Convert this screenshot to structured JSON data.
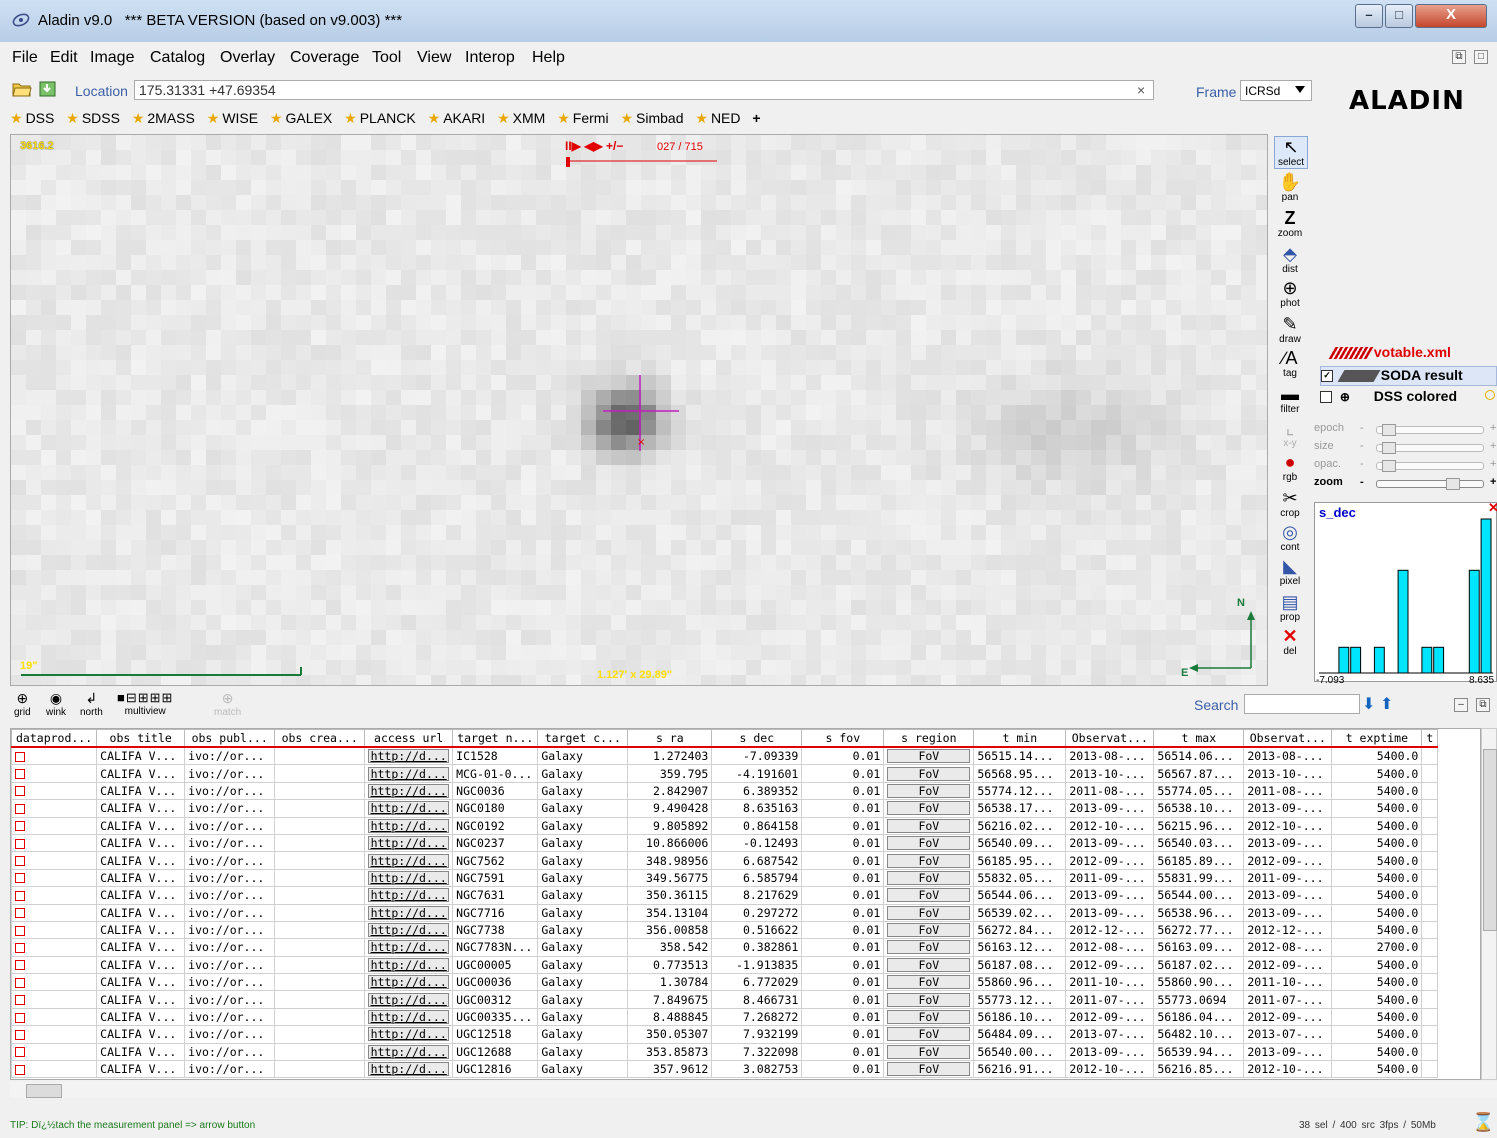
{
  "window": {
    "title": "Aladin v9.0   *** BETA VERSION (based on v9.003) ***",
    "min_label": "–",
    "max_label": "□",
    "close_label": "X"
  },
  "menu": [
    "File",
    "Edit",
    "Image",
    "Catalog",
    "Overlay",
    "Coverage",
    "Tool",
    "View",
    "Interop",
    "Help"
  ],
  "location": {
    "label": "Location",
    "value": "175.31331 +47.69354",
    "clear": "×"
  },
  "frame": {
    "label": "Frame",
    "value": "ICRSd"
  },
  "logo": "ALADIN",
  "servers": [
    "DSS",
    "SDSS",
    "2MASS",
    "WISE",
    "GALEX",
    "PLANCK",
    "AKARI",
    "XMM",
    "Fermi",
    "Simbad",
    "NED"
  ],
  "servers_add": "+",
  "view": {
    "pixel_value": "3616.2",
    "scale_label": "19\"",
    "fov": "1.127' x 29.89\"",
    "cube_controls": "II▶ ◀▶ +/−",
    "cube_frame": "027 / 715",
    "north": "N",
    "east": "E"
  },
  "tools": [
    "select",
    "pan",
    "zoom",
    "dist",
    "phot",
    "draw",
    "tag",
    "filter",
    "x-y",
    "rgb",
    "crop",
    "cont",
    "pixel",
    "prop",
    "del"
  ],
  "layers": [
    {
      "name": "votable.xml",
      "color": "#e00000"
    },
    {
      "name": "SODA result",
      "color": "#000000"
    },
    {
      "name": "DSS colored",
      "color": "#000000"
    }
  ],
  "sliders": [
    {
      "label": "epoch",
      "level": 0.05
    },
    {
      "label": "size",
      "level": 0.05
    },
    {
      "label": "opac.",
      "level": 0.05
    },
    {
      "label": "zoom",
      "level": 0.75
    }
  ],
  "histogram": {
    "title": "s_dec",
    "min": "-7.093",
    "max": "8.635",
    "bins": [
      0,
      1,
      1,
      0,
      1,
      0,
      4,
      0,
      1,
      1,
      0,
      0,
      4,
      6
    ],
    "bar_color": "#00e5ff"
  },
  "view_tools": [
    "grid",
    "wink",
    "north",
    "multiview",
    "match"
  ],
  "search": {
    "label": "Search"
  },
  "table": {
    "columns": [
      "dataprod...",
      "obs title",
      "obs publ...",
      "obs crea...",
      "access url",
      "target n...",
      "target c...",
      "s ra",
      "s dec",
      "s fov",
      "s region",
      "t min",
      "Observat...",
      "t max",
      "Observat...",
      "t exptime",
      "t"
    ],
    "rows": [
      [
        "CALIFA V...",
        "ivo://or...",
        "",
        "http://d...",
        "IC1528",
        "Galaxy",
        "1.272403",
        "-7.09339",
        "0.01",
        "FoV",
        "56515.14...",
        "2013-08-...",
        "56514.06...",
        "2013-08-...",
        "5400.0"
      ],
      [
        "CALIFA V...",
        "ivo://or...",
        "",
        "http://d...",
        "MCG-01-0...",
        "Galaxy",
        "359.795",
        "-4.191601",
        "0.01",
        "FoV",
        "56568.95...",
        "2013-10-...",
        "56567.87...",
        "2013-10-...",
        "5400.0"
      ],
      [
        "CALIFA V...",
        "ivo://or...",
        "",
        "http://d...",
        "NGC0036",
        "Galaxy",
        "2.842907",
        "6.389352",
        "0.01",
        "FoV",
        "55774.12...",
        "2011-08-...",
        "55774.05...",
        "2011-08-...",
        "5400.0"
      ],
      [
        "CALIFA V...",
        "ivo://or...",
        "",
        "http://d...",
        "NGC0180",
        "Galaxy",
        "9.490428",
        "8.635163",
        "0.01",
        "FoV",
        "56538.17...",
        "2013-09-...",
        "56538.10...",
        "2013-09-...",
        "5400.0"
      ],
      [
        "CALIFA V...",
        "ivo://or...",
        "",
        "http://d...",
        "NGC0192",
        "Galaxy",
        "9.805892",
        "0.864158",
        "0.01",
        "FoV",
        "56216.02...",
        "2012-10-...",
        "56215.96...",
        "2012-10-...",
        "5400.0"
      ],
      [
        "CALIFA V...",
        "ivo://or...",
        "",
        "http://d...",
        "NGC0237",
        "Galaxy",
        "10.866006",
        "-0.12493",
        "0.01",
        "FoV",
        "56540.09...",
        "2013-09-...",
        "56540.03...",
        "2013-09-...",
        "5400.0"
      ],
      [
        "CALIFA V...",
        "ivo://or...",
        "",
        "http://d...",
        "NGC7562",
        "Galaxy",
        "348.98956",
        "6.687542",
        "0.01",
        "FoV",
        "56185.95...",
        "2012-09-...",
        "56185.89...",
        "2012-09-...",
        "5400.0"
      ],
      [
        "CALIFA V...",
        "ivo://or...",
        "",
        "http://d...",
        "NGC7591",
        "Galaxy",
        "349.56775",
        "6.585794",
        "0.01",
        "FoV",
        "55832.05...",
        "2011-09-...",
        "55831.99...",
        "2011-09-...",
        "5400.0"
      ],
      [
        "CALIFA V...",
        "ivo://or...",
        "",
        "http://d...",
        "NGC7631",
        "Galaxy",
        "350.36115",
        "8.217629",
        "0.01",
        "FoV",
        "56544.06...",
        "2013-09-...",
        "56544.00...",
        "2013-09-...",
        "5400.0"
      ],
      [
        "CALIFA V...",
        "ivo://or...",
        "",
        "http://d...",
        "NGC7716",
        "Galaxy",
        "354.13104",
        "0.297272",
        "0.01",
        "FoV",
        "56539.02...",
        "2013-09-...",
        "56538.96...",
        "2013-09-...",
        "5400.0"
      ],
      [
        "CALIFA V...",
        "ivo://or...",
        "",
        "http://d...",
        "NGC7738",
        "Galaxy",
        "356.00858",
        "0.516622",
        "0.01",
        "FoV",
        "56272.84...",
        "2012-12-...",
        "56272.77...",
        "2012-12-...",
        "5400.0"
      ],
      [
        "CALIFA V...",
        "ivo://or...",
        "",
        "http://d...",
        "NGC7783N...",
        "Galaxy",
        "358.542",
        "0.382861",
        "0.01",
        "FoV",
        "56163.12...",
        "2012-08-...",
        "56163.09...",
        "2012-08-...",
        "2700.0"
      ],
      [
        "CALIFA V...",
        "ivo://or...",
        "",
        "http://d...",
        "UGC00005",
        "Galaxy",
        "0.773513",
        "-1.913835",
        "0.01",
        "FoV",
        "56187.08...",
        "2012-09-...",
        "56187.02...",
        "2012-09-...",
        "5400.0"
      ],
      [
        "CALIFA V...",
        "ivo://or...",
        "",
        "http://d...",
        "UGC00036",
        "Galaxy",
        "1.30784",
        "6.772029",
        "0.01",
        "FoV",
        "55860.96...",
        "2011-10-...",
        "55860.90...",
        "2011-10-...",
        "5400.0"
      ],
      [
        "CALIFA V...",
        "ivo://or...",
        "",
        "http://d...",
        "UGC00312",
        "Galaxy",
        "7.849675",
        "8.466731",
        "0.01",
        "FoV",
        "55773.12...",
        "2011-07-...",
        "55773.0694",
        "2011-07-...",
        "5400.0"
      ],
      [
        "CALIFA V...",
        "ivo://or...",
        "",
        "http://d...",
        "UGC00335...",
        "Galaxy",
        "8.488845",
        "7.268272",
        "0.01",
        "FoV",
        "56186.10...",
        "2012-09-...",
        "56186.04...",
        "2012-09-...",
        "5400.0"
      ],
      [
        "CALIFA V...",
        "ivo://or...",
        "",
        "http://d...",
        "UGC12518",
        "Galaxy",
        "350.05307",
        "7.932199",
        "0.01",
        "FoV",
        "56484.09...",
        "2013-07-...",
        "56482.10...",
        "2013-07-...",
        "5400.0"
      ],
      [
        "CALIFA V...",
        "ivo://or...",
        "",
        "http://d...",
        "UGC12688",
        "Galaxy",
        "353.85873",
        "7.322098",
        "0.01",
        "FoV",
        "56540.00...",
        "2013-09-...",
        "56539.94...",
        "2013-09-...",
        "5400.0"
      ],
      [
        "CALIFA V...",
        "ivo://or...",
        "",
        "http://d...",
        "UGC12816",
        "Galaxy",
        "357.9612",
        "3.082753",
        "0.01",
        "FoV",
        "56216.91...",
        "2012-10-...",
        "56216.85...",
        "2012-10-...",
        "5400.0"
      ]
    ]
  },
  "status": {
    "tip": "TIP: Dï¿½tach the measurement panel => arrow button",
    "stats": "38 sel / 400 src   3fps / 50Mb"
  }
}
